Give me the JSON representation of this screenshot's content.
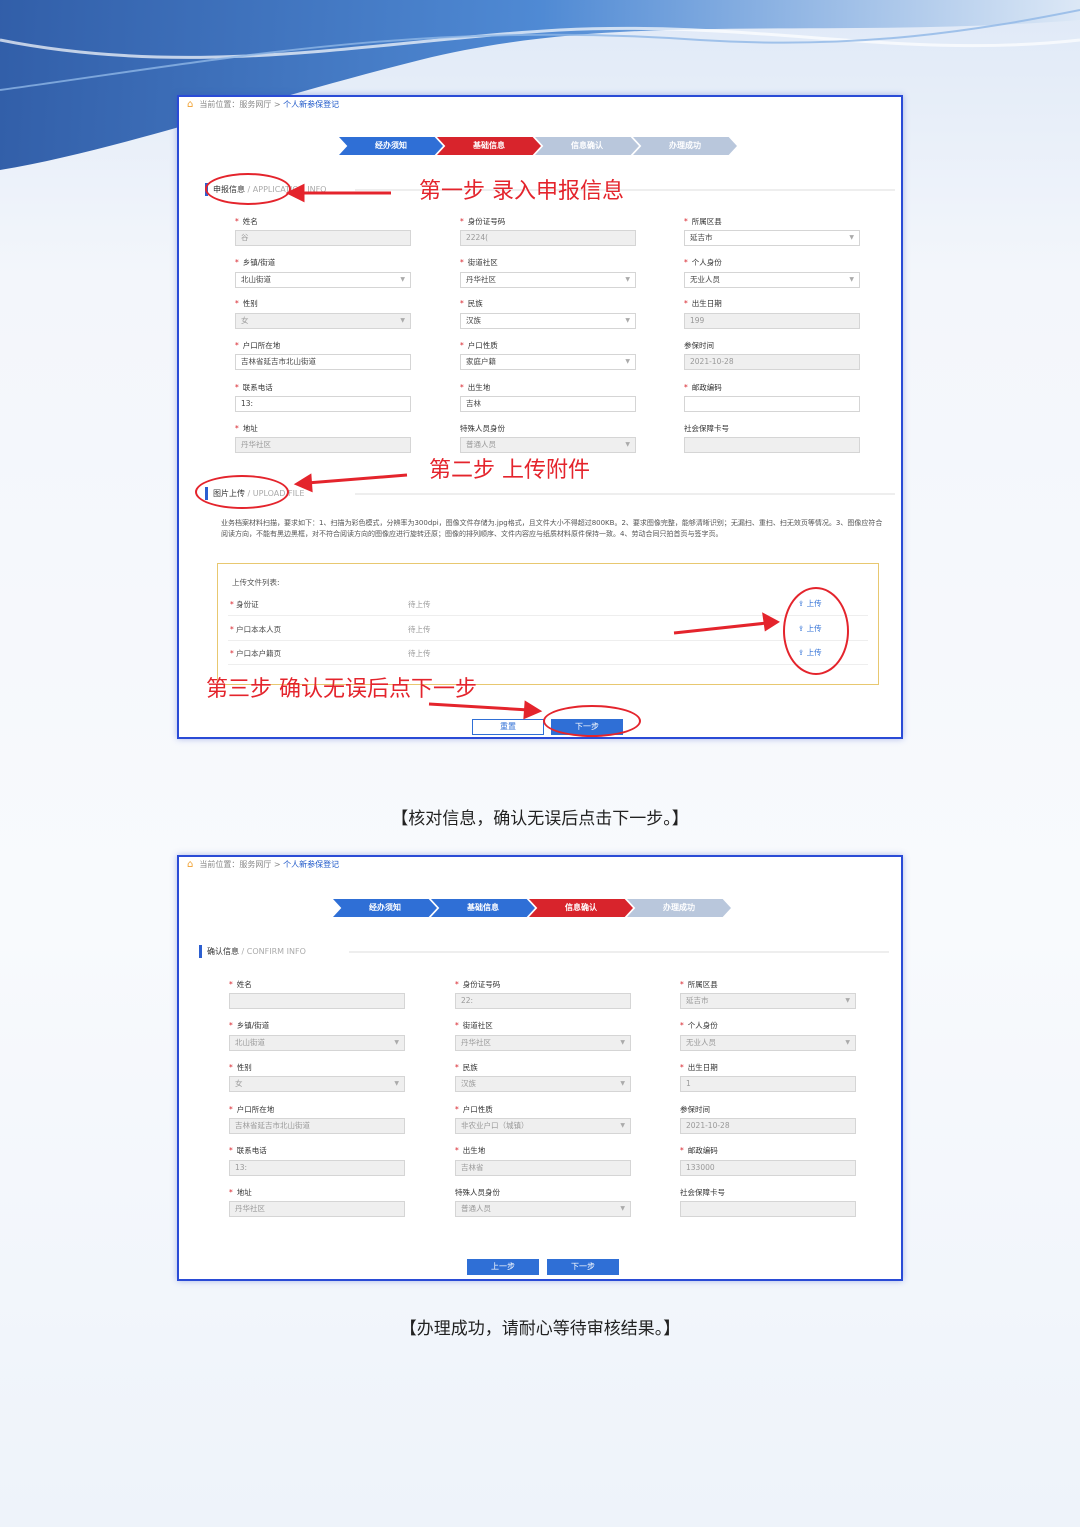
{
  "breadcrumb": {
    "prefix": "当前位置：服务网厅 > ",
    "current": "个人新参保登记"
  },
  "steps": [
    "经办须知",
    "基础信息",
    "信息确认",
    "办理成功"
  ],
  "form1": {
    "section_title": "申报信息",
    "section_sub": "/ APPLICATION INFO",
    "fields": {
      "name": {
        "label": "姓名",
        "value": "谷"
      },
      "id": {
        "label": "身份证号码",
        "value": "2224("
      },
      "district": {
        "label": "所属区县",
        "value": "延吉市"
      },
      "town": {
        "label": "乡镇/街道",
        "value": "北山街道"
      },
      "community": {
        "label": "街道社区",
        "value": "丹华社区"
      },
      "identity": {
        "label": "个人身份",
        "value": "无业人员"
      },
      "gender": {
        "label": "性别",
        "value": "女"
      },
      "ethnic": {
        "label": "民族",
        "value": "汉族"
      },
      "birth": {
        "label": "出生日期",
        "value": "199"
      },
      "hukou": {
        "label": "户口所在地",
        "value": "吉林省延吉市北山街道"
      },
      "hukou_type": {
        "label": "户口性质",
        "value": "家庭户籍"
      },
      "insure_time": {
        "label": "参保时间",
        "value": "2021-10-28"
      },
      "phone": {
        "label": "联系电话",
        "value": "13:"
      },
      "birthplace": {
        "label": "出生地",
        "value": "吉林"
      },
      "postcode": {
        "label": "邮政编码",
        "value": ""
      },
      "address": {
        "label": "地址",
        "value": "丹华社区"
      },
      "special": {
        "label": "特殊人员身份",
        "value": "普通人员"
      },
      "sscard": {
        "label": "社会保障卡号",
        "value": ""
      }
    },
    "upload_section_title": "图片上传",
    "upload_section_sub": "/ UPLOAD FILE",
    "upload_desc": "业务档案材料扫描，要求如下：1、扫描为彩色模式，分辨率为300dpi，图像文件存储为.jpg格式，且文件大小不得超过800KB。2、要求图像完整，能够清晰识别；无漏扫、重扫、扫无效页等情况。3、图像应符合阅读方向，不能有黑边黑框，对不符合阅读方向的图像应进行旋转还原；图像的排列顺序、文件内容应与纸质材料原件保持一致。4、劳动合同只拍首页与签字页。",
    "upload_list_title": "上传文件列表:",
    "uploads": [
      {
        "name": "身份证",
        "status": "待上传",
        "action": "上传"
      },
      {
        "name": "户口本本人页",
        "status": "待上传",
        "action": "上传"
      },
      {
        "name": "户口本户籍页",
        "status": "待上传",
        "action": "上传"
      }
    ],
    "reset_label": "重置",
    "next_label": "下一步"
  },
  "annotations": {
    "step1": "第一步 录入申报信息",
    "step2": "第二步 上传附件",
    "step3": "第三步 确认无误后点下一步"
  },
  "caption1": "【核对信息，确认无误后点击下一步。】",
  "form2": {
    "section_title": "确认信息",
    "section_sub": "/ CONFIRM INFO",
    "fields": {
      "name": {
        "label": "姓名",
        "value": ""
      },
      "id": {
        "label": "身份证号码",
        "value": "22:"
      },
      "district": {
        "label": "所属区县",
        "value": "延吉市"
      },
      "town": {
        "label": "乡镇/街道",
        "value": "北山街道"
      },
      "community": {
        "label": "街道社区",
        "value": "丹华社区"
      },
      "identity": {
        "label": "个人身份",
        "value": "无业人员"
      },
      "gender": {
        "label": "性别",
        "value": "女"
      },
      "ethnic": {
        "label": "民族",
        "value": "汉族"
      },
      "birth": {
        "label": "出生日期",
        "value": "1"
      },
      "hukou": {
        "label": "户口所在地",
        "value": "吉林省延吉市北山街道"
      },
      "hukou_type": {
        "label": "户口性质",
        "value": "非农业户口（城镇）"
      },
      "insure_time": {
        "label": "参保时间",
        "value": "2021-10-28"
      },
      "phone": {
        "label": "联系电话",
        "value": "13:"
      },
      "birthplace": {
        "label": "出生地",
        "value": "吉林省"
      },
      "postcode": {
        "label": "邮政编码",
        "value": "133000"
      },
      "address": {
        "label": "地址",
        "value": "丹华社区"
      },
      "special": {
        "label": "特殊人员身份",
        "value": "普通人员"
      },
      "sscard": {
        "label": "社会保障卡号",
        "value": ""
      }
    },
    "prev_label": "上一步",
    "next_label": "下一步"
  },
  "caption2": "【办理成功，请耐心等待审核结果。】",
  "colors": {
    "accent": "#2f6fd6",
    "active_step": "#d8242c",
    "annotation": "#e4242c",
    "frame": "#2a4bd6"
  }
}
